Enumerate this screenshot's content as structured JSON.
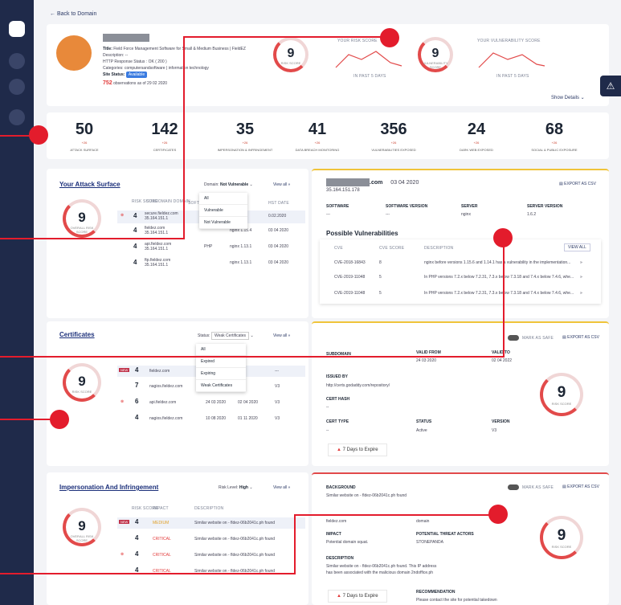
{
  "nav": {
    "back": "Back to Domain"
  },
  "header": {
    "title_label": "Title:",
    "title_value": "Field Force Management Software for Small & Medium Business | FieldEZ",
    "description": "Description: --",
    "http": "HTTP Response Status : OK ( 200 )",
    "categories": "Categories: computersandsoftware | information technology",
    "site_status_label": "Site Status:",
    "site_status": "Available",
    "observations_count": "752",
    "observations_text": "observations as of 29 02 2020",
    "risk_score": "9",
    "risk_score_label": "RISK SCORE",
    "vuln_score": "9",
    "vuln_score_label": "VULNERABILITY SCORE",
    "risk_chart_title": "YOUR RISK SCORE",
    "risk_chart_sub": "IN PAST 5 DAYS",
    "vuln_chart_title": "YOUR VULNERABILITY SCORE",
    "vuln_chart_sub": "IN PAST 5 DAYS",
    "show_details": "Show Details"
  },
  "stats": [
    {
      "value": "50",
      "delta": "+26",
      "label": "ATTACK SURFACE"
    },
    {
      "value": "142",
      "delta": "+26",
      "label": "CERTIFICATES"
    },
    {
      "value": "35",
      "delta": "+26",
      "label": "IMPERSONATION & INFRINGEMENT"
    },
    {
      "value": "41",
      "delta": "+26",
      "label": "DATA BREACH MONITORING"
    },
    {
      "value": "356",
      "delta": "+26",
      "label": "VULNERABILITIES EXPOSED"
    },
    {
      "value": "24",
      "delta": "+26",
      "label": "DARK WEB EXPOSED"
    },
    {
      "value": "68",
      "delta": "+26",
      "label": "SOCIAL & PUBLIC EXPOSURE"
    }
  ],
  "attack": {
    "title": "Your Attack Surface",
    "filter_label": "Domain:",
    "filter_value": "Not Vulnerable",
    "view_all": "View all",
    "score": "9",
    "score_label": "OVERALL RISK SCORE",
    "cols": [
      "RISK SCORE",
      "SUBDOMAIN DOMAIN",
      "SOFT",
      "",
      "HST DATE"
    ],
    "options": [
      "All",
      "Vulnerable",
      "Not Vulnerable"
    ],
    "rows": [
      {
        "score": "4",
        "domain": "secure.fieldez.com",
        "ip": "35.164.151.1",
        "server": "",
        "date": "0.02.2020"
      },
      {
        "score": "4",
        "domain": "fieldez.com",
        "ip": "35.164.151.1",
        "server": "nginx 1.15.4",
        "date": "03 04 2020"
      },
      {
        "score": "4",
        "domain": "api.fieldez.com",
        "ip": "35.164.151.1",
        "server": "nginx 1.13.1",
        "date": "03 04 2020"
      },
      {
        "score": "4",
        "domain": "ftp.fieldez.com",
        "ip": "35.164.151.1",
        "server": "nginx 1.13.1",
        "date": "03 04 2020"
      }
    ],
    "php": "PHP"
  },
  "vuln_detail": {
    "domain": ".com",
    "date": "03 04 2020",
    "ip": "35.164.151.178",
    "export": "EXPORT AS CSV",
    "software_label": "SOFTWARE",
    "software": "---",
    "sv_label": "SOFTWARE VERSION",
    "sv": "---",
    "server_label": "SERVER",
    "server": "nginx",
    "serv_ver_label": "SERVER VERSION",
    "serv_ver": "1.6.2",
    "possible": "Possible Vulnerabilities",
    "cols": [
      "CVE",
      "CVE SCORE",
      "DESCRIPTION"
    ],
    "view_all": "VIEW ALL",
    "rows": [
      {
        "cve": "CVE-2018-16843",
        "score": "8",
        "desc": "nginx before versions 1.15.6 and 1.14.1 has a vulnerability in the implementation..."
      },
      {
        "cve": "CVE-2019-11048",
        "score": "5",
        "desc": "In PHP versions 7.2.x below 7.2.31, 7.3.x below 7.3.18 and 7.4.x below 7.4.6, whe..."
      },
      {
        "cve": "CVE-2019-11048",
        "score": "5",
        "desc": "In PHP versions 7.2.x below 7.2.31, 7.3.x below 7.3.18 and 7.4.x below 7.4.6, whe..."
      }
    ]
  },
  "certs": {
    "title": "Certificates",
    "filter_label": "Status:",
    "filter_value": "Weak Certificates",
    "view_all": "View all",
    "score": "9",
    "score_label": "RISK SCORE",
    "options": [
      "All",
      "Expired",
      "Expiring",
      "Weak Certificates"
    ],
    "rows": [
      {
        "badge": "NEW",
        "score": "4",
        "domain": "fieldez.com",
        "from": "",
        "to": "",
        "ver": "---"
      },
      {
        "badge": "",
        "score": "7",
        "domain": "nagios.fieldez.com",
        "from": "",
        "to": "",
        "ver": "V3"
      },
      {
        "badge": "",
        "score": "6",
        "domain": "api.fieldez.com",
        "from": "24 03 2020",
        "to": "02 04 2020",
        "ver": "V3"
      },
      {
        "badge": "",
        "score": "4",
        "domain": "nagios.fieldez.com",
        "from": "10 08 2020",
        "to": "01 11 2020",
        "ver": "V3"
      }
    ]
  },
  "cert_detail": {
    "mark_safe": "MARK AS SAFE",
    "export": "EXPORT AS CSV",
    "subdomain_label": "SUBDOMAIN",
    "valid_from_label": "VALID FROM",
    "valid_from": "24 03 2020",
    "valid_to_label": "VALID TO",
    "valid_to": "02 04 2022",
    "issued_label": "ISSUED BY",
    "issued": "http://certs.godaddy.com/repository/",
    "hash_label": "CERT HASH",
    "hash": "--",
    "type_label": "CERT TYPE",
    "type": "--",
    "status_label": "STATUS",
    "status": "Active",
    "version_label": "VERSION",
    "version": "V3",
    "expire": "7 Days to Expire",
    "score": "9",
    "score_label": "RISK SCORE"
  },
  "imp": {
    "title": "Impersonation And Infringement",
    "filter_label": "Risk Level:",
    "filter_value": "High",
    "view_all": "View all",
    "score": "9",
    "score_label": "OVERALL RISK SCORE",
    "cols": [
      "RISK SCORE",
      "IMPACT",
      "DESCRIPTION"
    ],
    "rows": [
      {
        "badge": "NEW",
        "score": "4",
        "impact": "MEDIUM",
        "desc": "Similar website on - fldez-06b2041c.ph found"
      },
      {
        "badge": "",
        "score": "4",
        "impact": "CRITICAL",
        "desc": "Similar website on - fldez-06b2041c.ph found"
      },
      {
        "badge": "",
        "score": "4",
        "impact": "CRITICAL",
        "desc": "Similar website on - fldez-06b2041c.ph found"
      },
      {
        "badge": "",
        "score": "4",
        "impact": "CRITICAL",
        "desc": "Similar website on - fldez-06b2041c.ph found"
      }
    ]
  },
  "imp_detail": {
    "background_label": "BACKGROUND",
    "background": "Similar website on - fldez-06b2041c.ph found",
    "mark_safe": "MARK AS SAFE",
    "export": "EXPORT AS CSV",
    "asset": "fieldez.com",
    "asset_type": "domain",
    "impact_label": "IMPACT",
    "impact": "Potential domain squat.",
    "actors_label": "POTENTIAL THREAT ACTORS",
    "actors": "STONEPANDA",
    "desc_label": "DESCRIPTION",
    "desc1": "Similar website on - fldez-06b2041c.ph found. This IP address",
    "desc2": "has been associated with the malicious domain 2ndoffice.ph",
    "expire": "7 Days to Expire",
    "rec_label": "RECOMMENDATION",
    "rec": "Please contact the site for potential takedown",
    "score": "9",
    "score_label": "RISK SCORE"
  }
}
